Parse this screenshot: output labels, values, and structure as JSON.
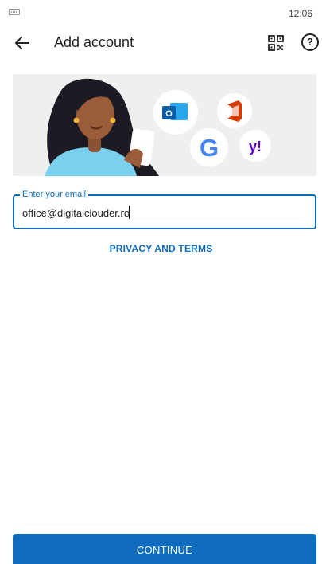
{
  "status_bar": {
    "time": "12:06",
    "keyboard_icon": "keyboard-icon"
  },
  "header": {
    "title": "Add account",
    "back_icon": "back-arrow-icon",
    "qr_icon": "qr-code-icon",
    "help_icon": "help-icon",
    "help_glyph": "?"
  },
  "hero": {
    "icons": [
      "outlook-icon",
      "microsoft-office-icon",
      "google-icon",
      "yahoo-icon"
    ],
    "outlook_letter": "O",
    "google_letter": "G",
    "yahoo_text": "y!"
  },
  "form": {
    "email_label": "Enter your email",
    "email_value": "office@digitalclouder.ro"
  },
  "links": {
    "privacy": "PRIVACY AND TERMS"
  },
  "actions": {
    "continue": "CONTINUE"
  },
  "colors": {
    "accent": "#0f6cbd",
    "hero_bg": "#efefef"
  }
}
